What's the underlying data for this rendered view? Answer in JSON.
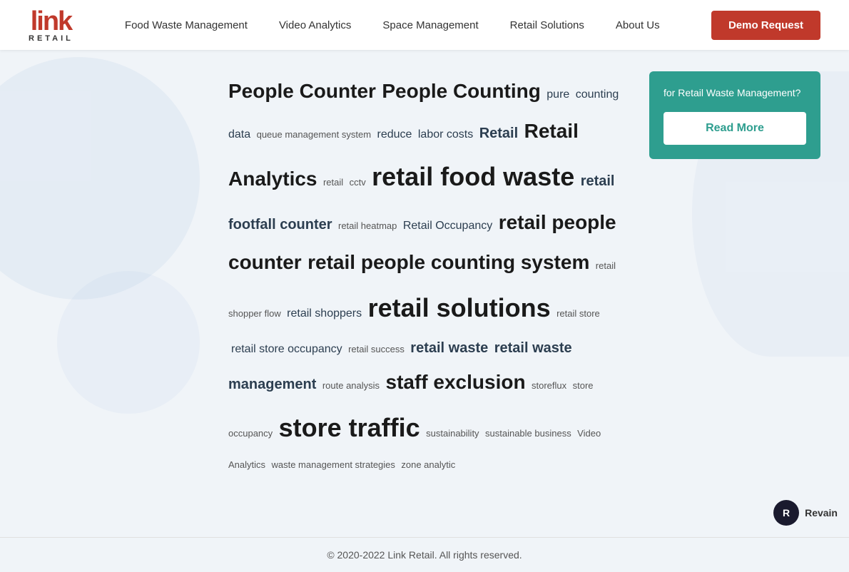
{
  "nav": {
    "logo_link": "link",
    "logo_retail": "RETAIL",
    "links": [
      {
        "label": "Food Waste Management",
        "id": "food-waste"
      },
      {
        "label": "Video Analytics",
        "id": "video-analytics"
      },
      {
        "label": "Space Management",
        "id": "space-management"
      },
      {
        "label": "Retail Solutions",
        "id": "retail-solutions"
      },
      {
        "label": "About Us",
        "id": "about-us"
      }
    ],
    "demo_btn": "Demo Request"
  },
  "promo_card": {
    "title": "for Retail Waste Management?",
    "read_more": "Read More"
  },
  "tags": [
    {
      "text": "People Counter",
      "size": "lg"
    },
    {
      "text": "People Counting",
      "size": "lg"
    },
    {
      "text": "pure",
      "size": "sm"
    },
    {
      "text": "counting data",
      "size": "sm"
    },
    {
      "text": "queue management system",
      "size": "xs"
    },
    {
      "text": "reduce",
      "size": "sm"
    },
    {
      "text": "labor costs",
      "size": "sm"
    },
    {
      "text": "Retail",
      "size": "md"
    },
    {
      "text": "Retail Analytics",
      "size": "lg"
    },
    {
      "text": "retail",
      "size": "xs"
    },
    {
      "text": "cctv",
      "size": "xs"
    },
    {
      "text": "retail food waste",
      "size": "xl"
    },
    {
      "text": "retail footfall counter",
      "size": "md"
    },
    {
      "text": "retail heatmap",
      "size": "xs"
    },
    {
      "text": "Retail Occupancy",
      "size": "sm"
    },
    {
      "text": "retail people counter",
      "size": "lg"
    },
    {
      "text": "retail people counting system",
      "size": "lg"
    },
    {
      "text": "retail shopper flow",
      "size": "xs"
    },
    {
      "text": "retail shoppers",
      "size": "sm"
    },
    {
      "text": "retail solutions",
      "size": "xl"
    },
    {
      "text": "retail store",
      "size": "xs"
    },
    {
      "text": "retail store occupancy",
      "size": "sm"
    },
    {
      "text": "retail success",
      "size": "xs"
    },
    {
      "text": "retail waste",
      "size": "md"
    },
    {
      "text": "retail waste management",
      "size": "md"
    },
    {
      "text": "route analysis",
      "size": "xs"
    },
    {
      "text": "staff exclusion",
      "size": "lg"
    },
    {
      "text": "storeflux",
      "size": "xs"
    },
    {
      "text": "store occupancy",
      "size": "xs"
    },
    {
      "text": "store traffic",
      "size": "xl"
    },
    {
      "text": "sustainability",
      "size": "xs"
    },
    {
      "text": "sustainable business",
      "size": "xs"
    },
    {
      "text": "Video Analytics",
      "size": "xs"
    },
    {
      "text": "waste management strategies",
      "size": "xs"
    },
    {
      "text": "zone analytic",
      "size": "xs"
    }
  ],
  "footer": {
    "copyright": "© 2020-2022 Link Retail. All rights reserved."
  },
  "revain": {
    "label": "Revain"
  }
}
